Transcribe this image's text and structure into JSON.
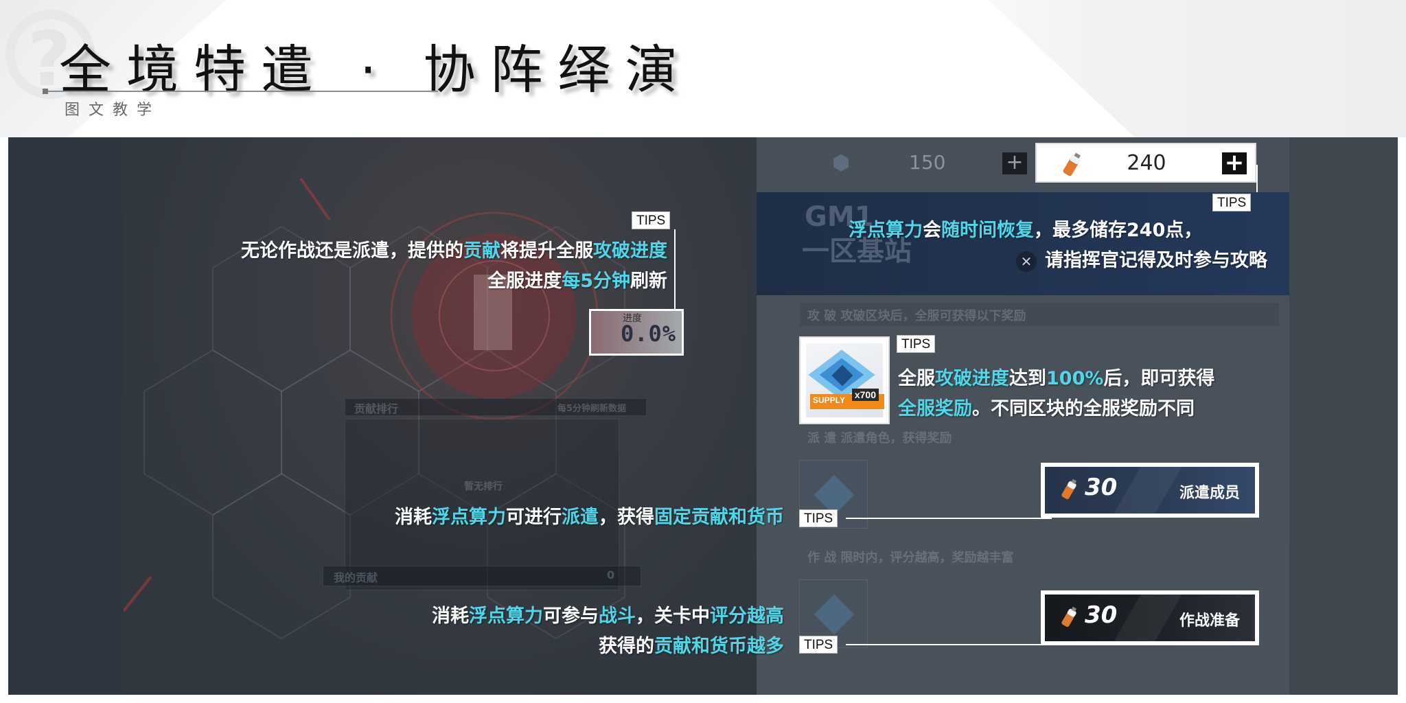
{
  "header": {
    "title": "全境特遣 · 协阵绎演",
    "subtitle": "图文教学"
  },
  "resources": {
    "left_value": "150",
    "right_value": "240"
  },
  "progress": {
    "label": "进度",
    "value": "0.0%"
  },
  "reward": {
    "strip_label": "SUPPLY",
    "quantity": "x700"
  },
  "game_ui": {
    "banner_code": "GM1",
    "banner_name": "一区基站",
    "attack_row": "攻 破  攻破区块后，全服可获得以下奖励",
    "dispatch_row": "派 遣  派遣角色，获得奖励",
    "battle_row": "作 战  限时内，评分越高，奖励越丰富",
    "rank_title": "贡献排行",
    "rank_refresh": "每5分钟刷新数据",
    "rank_empty": "暂无排行",
    "my_contribution": "我的贡献",
    "my_contribution_value": "0"
  },
  "tips_label": "TIPS",
  "notes": {
    "contribution_line1": [
      "无论作战还是派遣，提供的",
      "贡献",
      "将提升全服",
      "攻破进度"
    ],
    "contribution_line2": [
      "全服进度",
      "每5分钟",
      "刷新"
    ],
    "recover_line1": [
      "浮点算力",
      "会",
      "随时间恢复",
      "，最多储存240点，"
    ],
    "recover_line2": "请指挥官记得及时参与攻略",
    "reward_line1": [
      "全服",
      "攻破进度",
      "达到",
      "100%",
      "后，即可获得"
    ],
    "reward_line2": [
      "全服奖励",
      "。不同区块的全服奖励不同"
    ],
    "dispatch_line": [
      "消耗",
      "浮点算力",
      "可进行",
      "派遣",
      "，获得",
      "固定贡献和货币"
    ],
    "battle_line1": [
      "消耗",
      "浮点算力",
      "可参与",
      "战斗",
      "，关卡中",
      "评分越高"
    ],
    "battle_line2": [
      "获得的",
      "贡献和货币越多"
    ]
  },
  "buttons": {
    "dispatch": {
      "cost": "30",
      "label": "派遣成员"
    },
    "battle": {
      "cost": "30",
      "label": "作战准备"
    }
  },
  "colors": {
    "highlight": "#4fd6e8",
    "panel": "#2e3640",
    "banner": "#24385a"
  }
}
